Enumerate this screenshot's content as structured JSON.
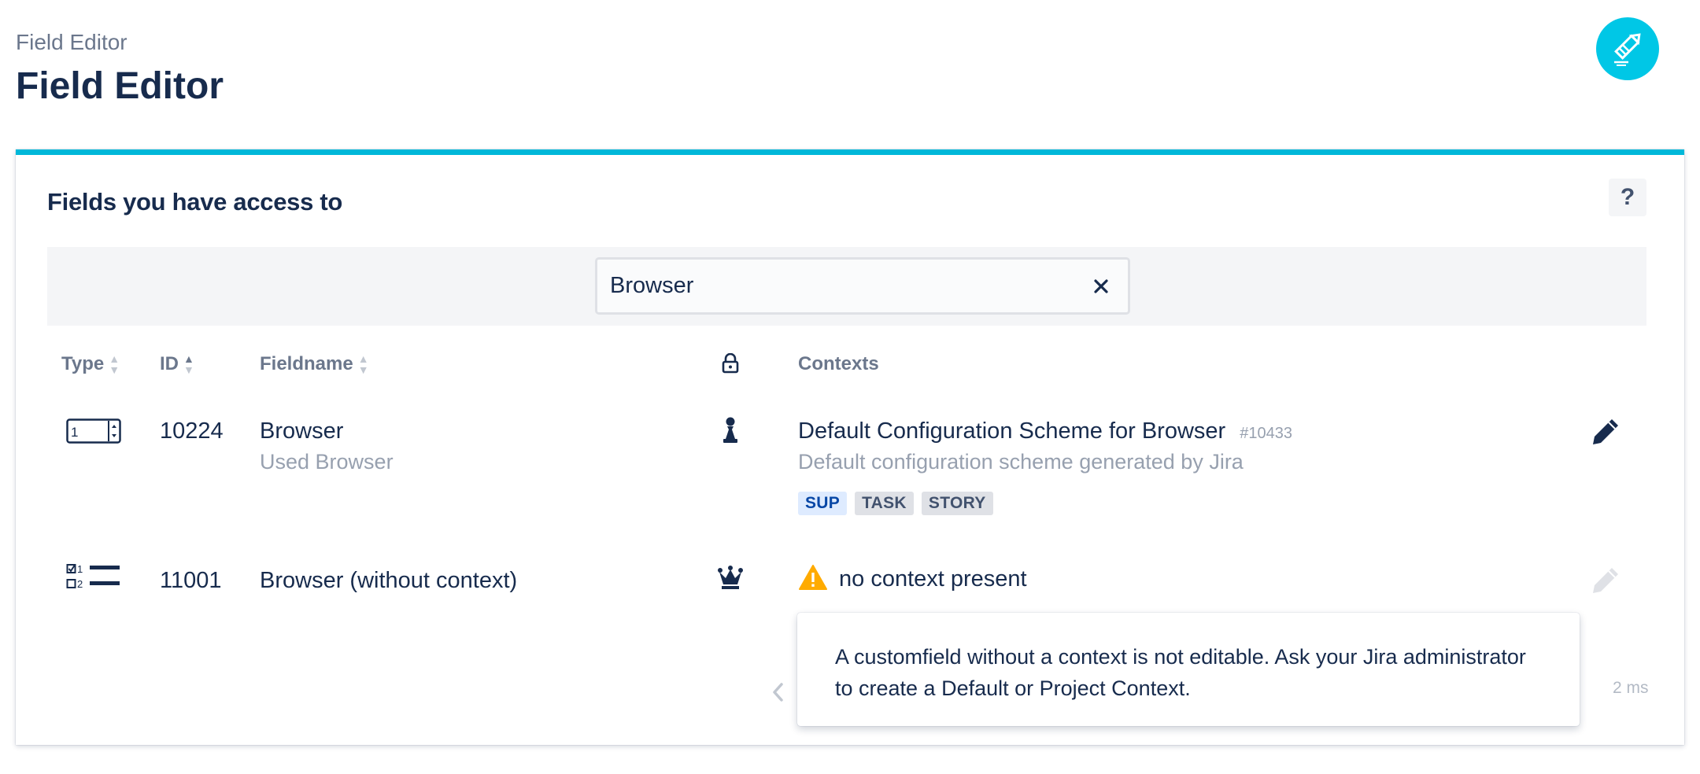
{
  "header": {
    "breadcrumb": "Field Editor",
    "title": "Field Editor",
    "logo_icon": "pencil-icon"
  },
  "panel": {
    "title": "Fields you have access to",
    "help_label": "?",
    "search": {
      "value": "Browser",
      "clear_icon": "close-icon"
    },
    "columns": {
      "type": "Type",
      "id": "ID",
      "fieldname": "Fieldname",
      "lock_icon": "lock-icon",
      "contexts": "Contexts"
    },
    "rows": [
      {
        "type_icon": "number-field-icon",
        "id": "10224",
        "name": "Browser",
        "description": "Used Browser",
        "access_icon": "pawn-icon",
        "context": {
          "name": "Default Configuration Scheme for Browser",
          "id": "#10433",
          "description": "Default configuration scheme generated by Jira",
          "issue_types": [
            "SUP",
            "TASK",
            "STORY"
          ]
        },
        "edit_icon": "pencil-icon",
        "editable": true
      },
      {
        "type_icon": "checklist-field-icon",
        "id": "11001",
        "name": "Browser (without context)",
        "access_icon": "crown-icon",
        "context_warning": "no context present",
        "edit_icon": "pencil-icon",
        "editable": false
      }
    ],
    "tooltip": "A customfield without a context is not editable. Ask your Jira administrator to create a Default or Project Context.",
    "timing": "2 ms"
  },
  "colors": {
    "accent": "#00b8d9",
    "logo_bg": "#00c7e6",
    "text": "#172b4d",
    "muted": "#6b778c",
    "warning": "#ffab00"
  }
}
